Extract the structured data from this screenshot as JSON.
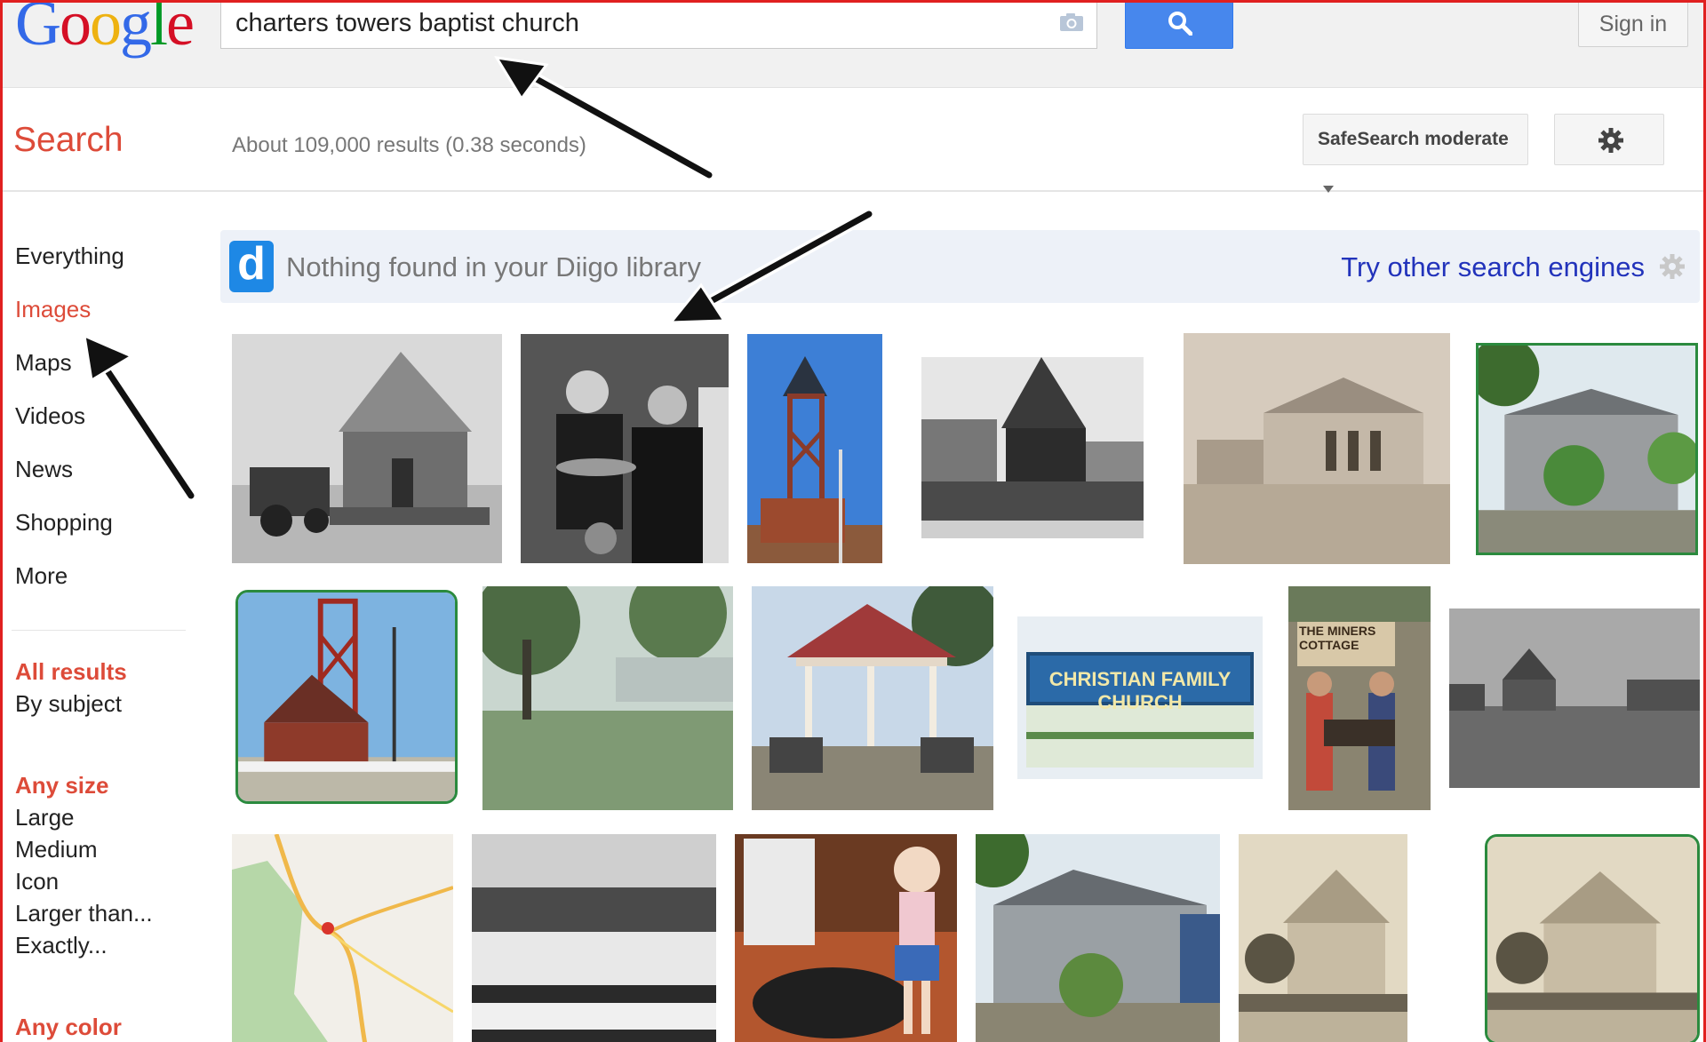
{
  "logo": {
    "letters": [
      "G",
      "o",
      "o",
      "g",
      "l",
      "e"
    ]
  },
  "search": {
    "query": "charters towers baptist church",
    "label": "Search",
    "result_stats": "About 109,000 results (0.38 seconds)",
    "safesearch": "SafeSearch moderate"
  },
  "header": {
    "sign_in": "Sign in"
  },
  "nav": {
    "items": [
      "Everything",
      "Images",
      "Maps",
      "Videos",
      "News",
      "Shopping",
      "More"
    ],
    "active": "Images"
  },
  "filters": {
    "results_head": "All results",
    "results_items": [
      "By subject"
    ],
    "size_head": "Any size",
    "size_items": [
      "Large",
      "Medium",
      "Icon",
      "Larger than...",
      "Exactly..."
    ],
    "color_head": "Any color"
  },
  "diigo": {
    "logo_letter": "d",
    "message": "Nothing found in your Diigo library",
    "link": "Try other search engines"
  },
  "thumbnails": {
    "row3_5_labels": [
      "CHRISTIAN FAMILY CHURCH",
      "THE MINERS COTTAGE"
    ]
  },
  "colors": {
    "accent_red": "#dd4b39",
    "search_blue": "#4787ed",
    "link_blue": "#2233bb",
    "frame_red": "#e02020"
  }
}
